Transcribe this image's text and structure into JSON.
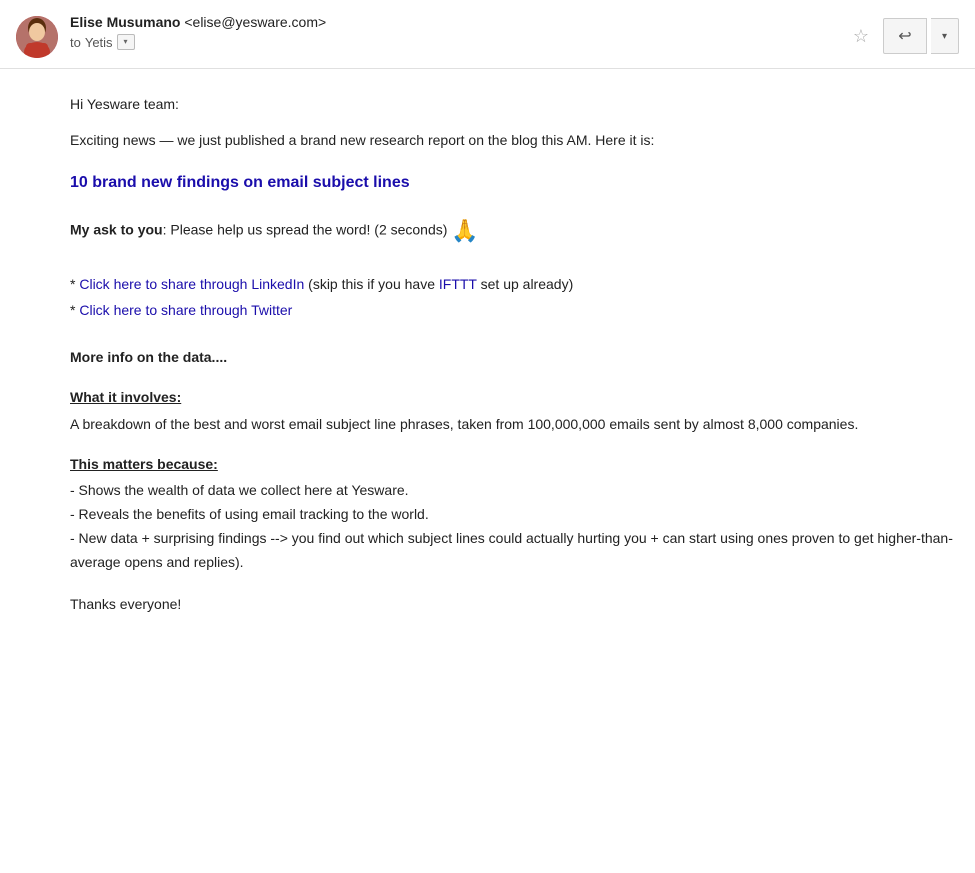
{
  "header": {
    "sender_name": "Elise Musumano",
    "sender_email": "<elise@yesware.com>",
    "to_label": "to",
    "to_recipient": "Yetis",
    "avatar_emoji": "👩"
  },
  "actions": {
    "star_icon": "☆",
    "reply_icon": "↩",
    "more_icon": "▾"
  },
  "body": {
    "greeting": "Hi Yesware team:",
    "intro": "Exciting news — we just published a brand new research report on the blog this AM. Here it is:",
    "link_text": "10 brand new findings on email subject lines",
    "link_url": "#",
    "ask_bold": "My ask to you",
    "ask_text": ": Please help us spread the word! (2 seconds)",
    "prayer_emoji": "🙏",
    "linkedin_label": "Click here to share through LinkedIn",
    "linkedin_note": " (skip this if you have ",
    "ifttt_label": "IFTTT",
    "linkedin_note2": " set up already)",
    "twitter_label": "Click here to share through Twitter",
    "more_info_heading": "More info on the data....",
    "what_involves_title": "What it involves:",
    "what_involves_text": "A breakdown of the best and worst email subject line phrases, taken from 100,000,000 emails sent by almost 8,000 companies.",
    "this_matters_title": "This matters because:",
    "bullet1": "- Shows the wealth of data we collect here at Yesware.",
    "bullet2": "- Reveals the benefits of using email tracking to the world.",
    "bullet3": "- New data + surprising findings --> you find out which subject lines could actually hurting you + can start using ones proven to get higher-than-average opens and replies).",
    "thanks": "Thanks everyone!"
  }
}
